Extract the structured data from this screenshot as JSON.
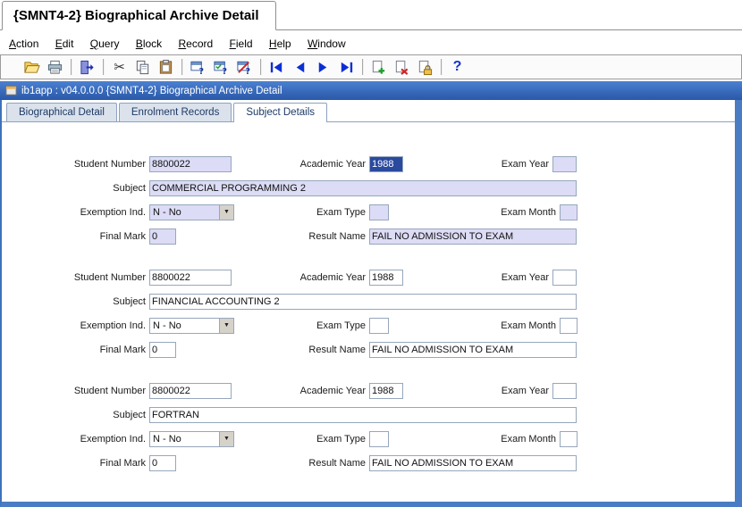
{
  "window_tab": {
    "title": "{SMNT4-2} Biographical Archive Detail"
  },
  "menu_bar": {
    "items": [
      "Action",
      "Edit",
      "Query",
      "Block",
      "Record",
      "Field",
      "Help",
      "Window"
    ]
  },
  "toolbar": {
    "icons": [
      "save-icon",
      "print-icon",
      "exit-icon",
      "cut-icon",
      "copy-icon",
      "paste-icon",
      "enter-query-icon",
      "execute-query-icon",
      "cancel-query-icon",
      "previous-block-icon",
      "previous-record-icon",
      "next-record-icon",
      "next-block-icon",
      "insert-record-icon",
      "delete-record-icon",
      "lock-record-icon",
      "help-icon"
    ],
    "glyphs": {
      "cut": "✂",
      "help": "?",
      "query_badge": "?"
    }
  },
  "icons": {
    "combo_arrow": "▼"
  },
  "app_bar": {
    "title": "ib1app : v04.0.0.0  {SMNT4-2} Biographical Archive Detail"
  },
  "tabs": {
    "items": [
      {
        "label": "Biographical Detail"
      },
      {
        "label": "Enrolment Records"
      },
      {
        "label": "Subject Details"
      }
    ],
    "active": "Subject Details"
  },
  "form": {
    "labels": {
      "student_number": "Student Number",
      "academic_year": "Academic Year",
      "exam_year": "Exam Year",
      "subject": "Subject",
      "exemption_ind": "Exemption Ind.",
      "exam_type": "Exam Type",
      "exam_month": "Exam Month",
      "final_mark": "Final Mark",
      "result_name": "Result Name"
    },
    "records": [
      {
        "student_number": "8800022",
        "academic_year": "1988",
        "exam_year": "",
        "subject": "COMMERCIAL PROGRAMMING 2",
        "exemption_ind": "N - No",
        "exam_type": "",
        "exam_month": "",
        "final_mark": "0",
        "result_name": "FAIL NO ADMISSION TO EXAM"
      },
      {
        "student_number": "8800022",
        "academic_year": "1988",
        "exam_year": "",
        "subject": "FINANCIAL ACCOUNTING 2",
        "exemption_ind": "N - No",
        "exam_type": "",
        "exam_month": "",
        "final_mark": "0",
        "result_name": "FAIL NO ADMISSION TO EXAM"
      },
      {
        "student_number": "8800022",
        "academic_year": "1988",
        "exam_year": "",
        "subject": "FORTRAN",
        "exemption_ind": "N - No",
        "exam_type": "",
        "exam_month": "",
        "final_mark": "0",
        "result_name": "FAIL NO ADMISSION TO EXAM"
      }
    ]
  }
}
